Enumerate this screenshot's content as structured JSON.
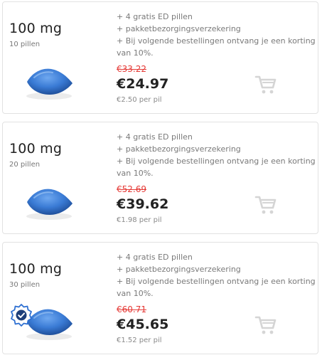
{
  "products": [
    {
      "dose": "100 mg",
      "count": "10 pillen",
      "bullets": [
        "+ 4 gratis ED pillen",
        "+ pakketbezorgingsverzekering",
        "+ Bij volgende bestellingen ontvang je een korting",
        "van 10%."
      ],
      "old_price": "€33.22",
      "price": "€24.97",
      "per_pil": "€2.50 per pil",
      "badge": false
    },
    {
      "dose": "100 mg",
      "count": "20 pillen",
      "bullets": [
        "+ 4 gratis ED pillen",
        "+ pakketbezorgingsverzekering",
        "+ Bij volgende bestellingen ontvang je een korting",
        "van 10%."
      ],
      "old_price": "€52.69",
      "price": "€39.62",
      "per_pil": "€1.98 per pil",
      "badge": false
    },
    {
      "dose": "100 mg",
      "count": "30 pillen",
      "bullets": [
        "+ 4 gratis ED pillen",
        "+ pakketbezorgingsverzekering",
        "+ Bij volgende bestellingen ontvang je een korting",
        "van 10%."
      ],
      "old_price": "€60.71",
      "price": "€45.65",
      "per_pil": "€1.52 per pil",
      "badge": true
    }
  ],
  "icons": {
    "cart": "shopping-cart-icon",
    "pill": "blue-pill-icon",
    "badge": "verified-badge-icon"
  },
  "colors": {
    "old_price": "#e53935",
    "pill": "#3a7bd5",
    "badge": "#2d6fd1",
    "cart": "#d5d5d5",
    "border": "#e2e2e2"
  }
}
